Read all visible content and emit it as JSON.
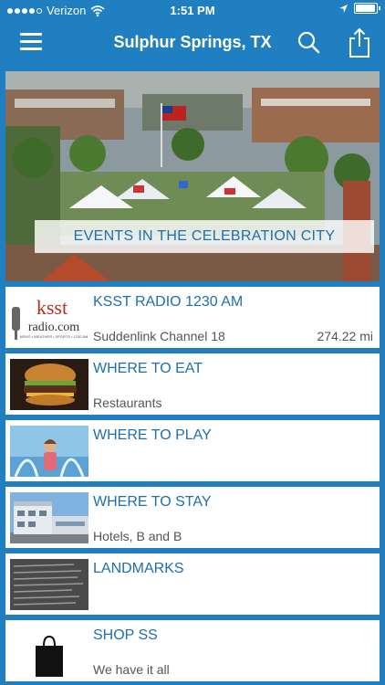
{
  "status_bar": {
    "carrier": "Verizon",
    "time": "1:51 PM",
    "battery_level": 0.95
  },
  "nav": {
    "title": "Sulphur Springs, TX"
  },
  "hero": {
    "banner": "EVENTS IN THE CELEBRATION CITY"
  },
  "list": [
    {
      "title": "KSST RADIO 1230 AM",
      "subtitle": "Suddenlink Channel 18",
      "distance": "274.22 mi",
      "logo_main": "ksst",
      "logo_sub": "radio.com",
      "logo_tagline": "NEWS • WEATHER • SPORTS • 1230 AM"
    },
    {
      "title": "WHERE TO EAT",
      "subtitle": "Restaurants"
    },
    {
      "title": "WHERE TO PLAY",
      "subtitle": ""
    },
    {
      "title": "WHERE TO STAY",
      "subtitle": "Hotels, B and B"
    },
    {
      "title": "LANDMARKS",
      "subtitle": ""
    },
    {
      "title": "SHOP SS",
      "subtitle": "We have it all"
    }
  ],
  "colors": {
    "brand_blue": "#1f7fc1",
    "title_blue": "#1d6fae",
    "ksst_red": "#b5321e"
  },
  "icons": [
    "signal-dots-icon",
    "wifi-icon",
    "location-arrow-icon",
    "battery-icon",
    "menu-icon",
    "search-icon",
    "share-icon",
    "shopping-bag-icon"
  ]
}
